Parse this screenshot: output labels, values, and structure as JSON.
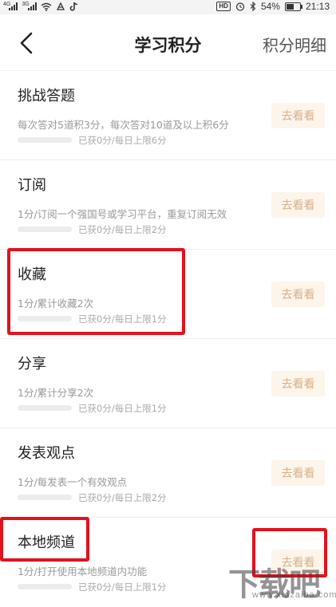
{
  "status_bar": {
    "sim1_label": "4G",
    "sim2_label": "3G",
    "hd_label": "HD",
    "battery_percent": "54%",
    "battery_level": 0.54,
    "time": "21:13",
    "icons": [
      "signal-icon",
      "signal-icon",
      "wifi-icon",
      "notification-icon",
      "tiktok-icon",
      "hd-icon",
      "alarm-icon",
      "bluetooth-icon",
      "battery-icon"
    ]
  },
  "header": {
    "title": "学习积分",
    "detail_link": "积分明细",
    "back_icon": "chevron-left-icon"
  },
  "items": [
    {
      "title": "挑战答题",
      "desc": "每次答对5道积3分，每次答对10道及以上积6分",
      "status": "已获0分/每日上限6分",
      "progress": 0,
      "button": "去看看"
    },
    {
      "title": "订阅",
      "desc": "1分/订阅一个强国号或学习平台，重复订阅无效",
      "status": "已获0分/每日上限2分",
      "progress": 0,
      "button": "去看看"
    },
    {
      "title": "收藏",
      "desc": "1分/累计收藏2次",
      "status": "已获0分/每日上限1分",
      "progress": 0,
      "button": "去看看"
    },
    {
      "title": "分享",
      "desc": "1分/累计分享2次",
      "status": "已获0分/每日上限1分",
      "progress": 0,
      "button": "去看看"
    },
    {
      "title": "发表观点",
      "desc": "1分/每发表一个有效观点",
      "status": "已获0分/每日上限2分",
      "progress": 0,
      "button": "去看看"
    },
    {
      "title": "本地频道",
      "desc": "1分/打开使用本地频道内功能",
      "status": "已获0分/每日上限1分",
      "progress": 0,
      "button": "去看看"
    }
  ],
  "colors": {
    "highlight": "#e3111d",
    "button_bg": "#fdf4ea",
    "button_text": "#d7b08a"
  },
  "watermark": {
    "main": "下载吧",
    "url": "www.xiazaiba.com"
  }
}
